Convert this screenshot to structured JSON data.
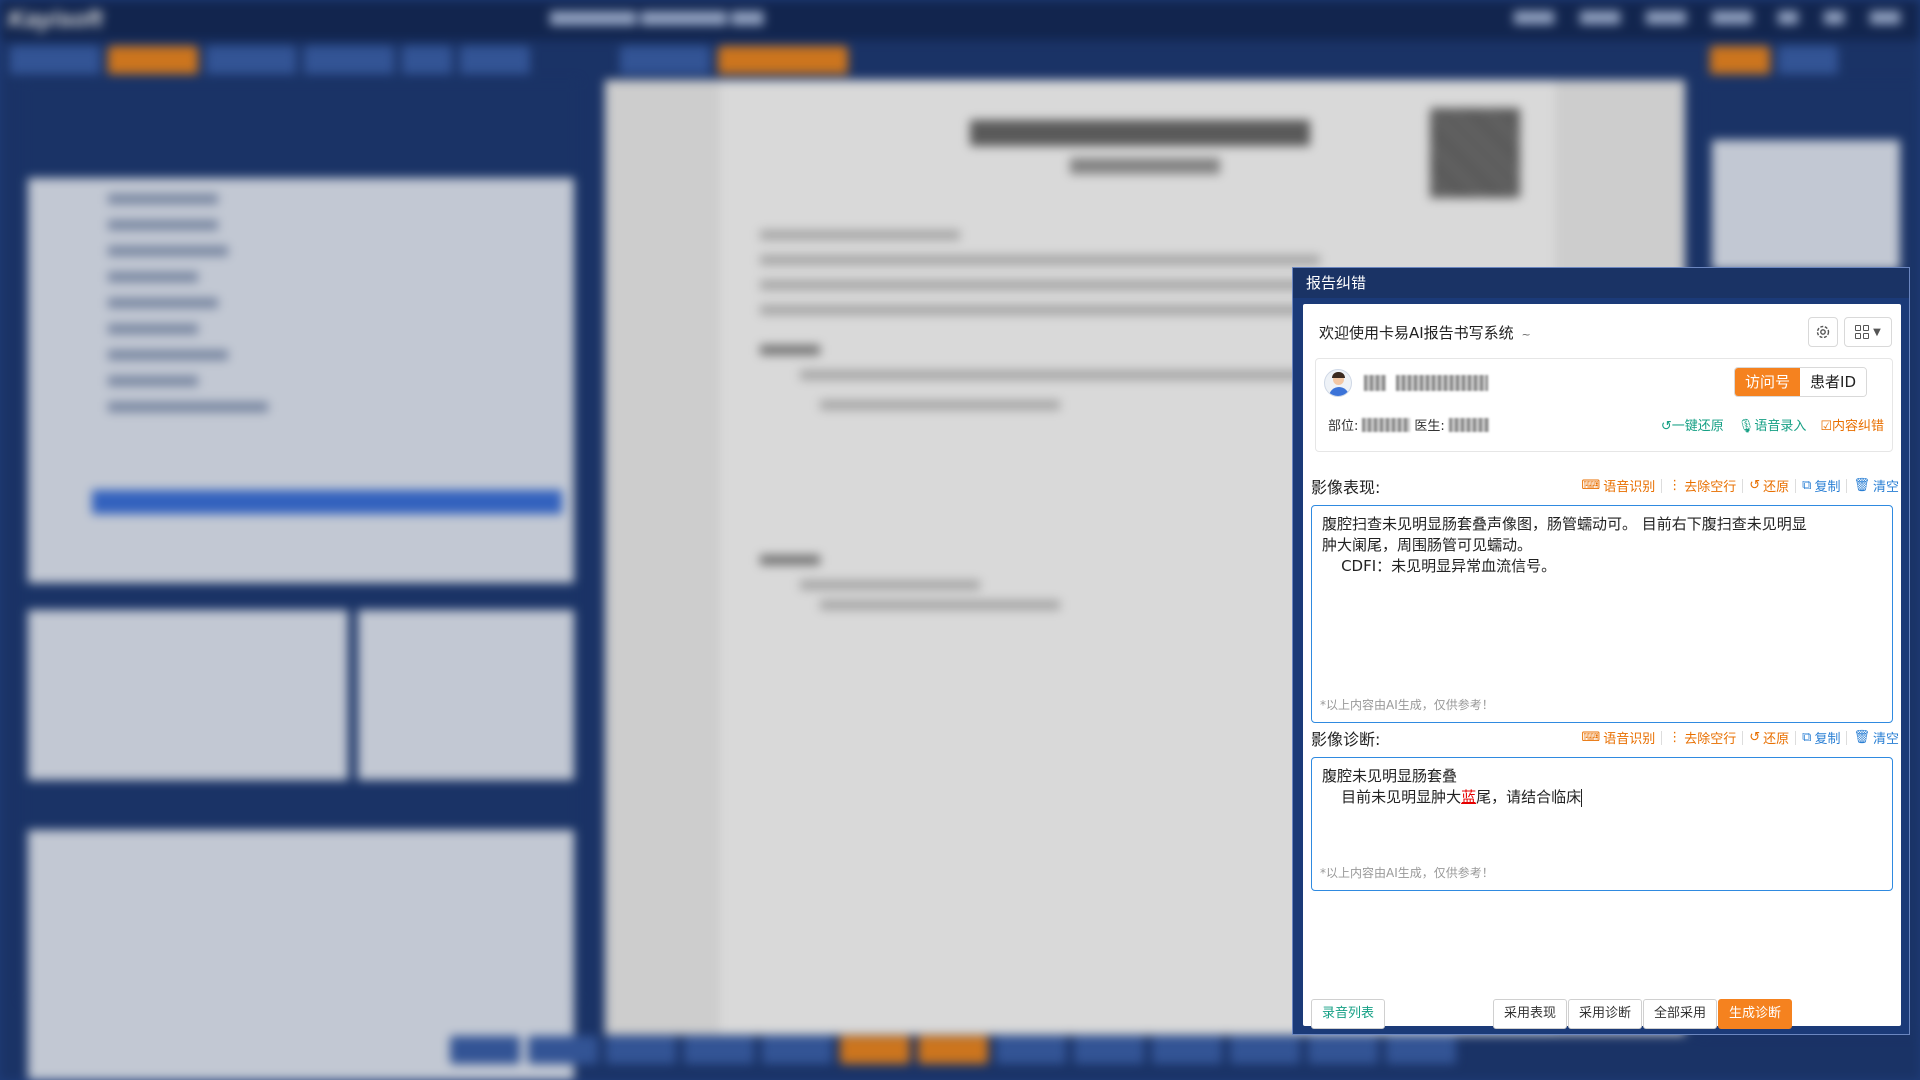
{
  "app": {
    "logo": "Kayisoft"
  },
  "dialog": {
    "title": "报告纠错",
    "welcome": "欢迎使用卡易AI报告书写系统",
    "welcome_caret": "~",
    "patient": {
      "id_toggle_active": "访问号",
      "id_toggle_inactive": "患者ID",
      "dept_label": "部位:",
      "doctor_label": "医生:"
    },
    "patient_actions": [
      {
        "label": "一键还原",
        "icon": "undo-icon"
      },
      {
        "label": "语音录入",
        "icon": "microphone-icon"
      },
      {
        "label": "内容纠错",
        "icon": "checkbox-edit-icon"
      }
    ],
    "findings": {
      "label": "影像表现:",
      "text_line1": "腹腔扫查未见明显肠套叠声像图，肠管蠕动可。 目前右下腹扫查未见明显",
      "text_line2": "肿大阑尾，周围肠管可见蠕动。",
      "text_line3": "    CDFI：未见明显异常血流信号。",
      "ai_note": "*以上内容由AI生成，仅供参考！"
    },
    "diagnosis": {
      "label": "影像诊断:",
      "text_line1": "腹腔未见明显肠套叠",
      "text_line2_pre": "    目前未见明显肿大",
      "text_line2_err": "蓝",
      "text_line2_post": "尾，请结合临床",
      "ai_note": "*以上内容由AI生成，仅供参考！"
    },
    "toolbar": [
      {
        "label": "语音识别",
        "icon": "voice-recognition-icon",
        "color": "orange"
      },
      {
        "label": "去除空行",
        "icon": "remove-blank-lines-icon",
        "color": "orange"
      },
      {
        "label": "还原",
        "icon": "undo-icon",
        "color": "orange"
      },
      {
        "label": "复制",
        "icon": "copy-icon",
        "color": "blue"
      },
      {
        "label": "清空",
        "icon": "trash-icon",
        "color": "blue"
      }
    ],
    "footer": {
      "recording_list": "录音列表",
      "adopt_findings": "采用表现",
      "adopt_diagnosis": "采用诊断",
      "adopt_all": "全部采用",
      "generate_diagnosis": "生成诊断"
    }
  },
  "colors": {
    "accent_orange": "#f5821f",
    "action_green": "#16a085",
    "link_blue": "#2a7fd4",
    "error_red": "#e60000",
    "dialog_frame": "#1b3a78"
  }
}
